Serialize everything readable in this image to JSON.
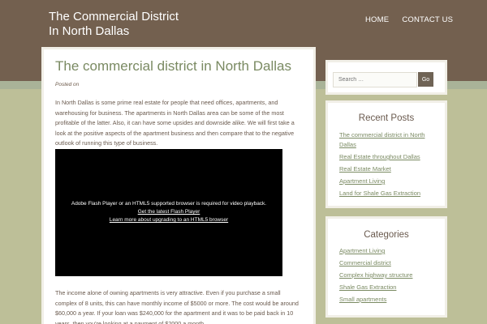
{
  "site": {
    "title_line1": "The Commercial District",
    "title_line2": "In North Dallas"
  },
  "nav": {
    "home": "HOME",
    "contact": "CONTACT US"
  },
  "post": {
    "title": "The commercial district in North Dallas",
    "posted_on": "Posted on",
    "paragraph1": "In North Dallas is some prime real estate for people that need offices, apartments, and warehousing for business. The apartments in North Dallas area can be some of the most profitable of the latter. Also, it can have some upsides and downside alike. We will first take a look at the positive aspects of the apartment business and then compare that to the negative outlook of running this type of business.",
    "video": {
      "message": "Adobe Flash Player or an HTML5 supported browser is required for video playback.",
      "link1": "Get the latest Flash Player",
      "link2": "Learn more about upgrading to an HTML5 browser"
    },
    "paragraph2": "The income alone of owning apartments is very attractive. Even if you purchase a small complex of 8 units, this can have monthly income of $5000 or more. The cost would be around $60,000 a year. If your loan was $240,000 for the apartment and it was to be paid back in 10 years, then you're looking at a payment of $2000 a month."
  },
  "search": {
    "placeholder": "Search …",
    "button": "Go"
  },
  "recent_posts": {
    "title": "Recent Posts",
    "items": [
      "The commercial district in North Dallas",
      "Real Estate throughout Dallas",
      "Real Estate Market",
      "Apartment Living",
      "Land for Shale Gas Extraction"
    ]
  },
  "categories": {
    "title": "Categories",
    "items": [
      "Apartment Living",
      "Commercial district",
      "Complex highway structure",
      "Shale Gas Extraction",
      "Small apartments"
    ]
  },
  "colors": {
    "header_brown": "#73604f",
    "stripe_green": "#a9b398",
    "page_olive": "#bdbf98",
    "link_green": "#7a8a62",
    "text_brown": "#6a5a4e",
    "button_brown": "#6f6355"
  }
}
